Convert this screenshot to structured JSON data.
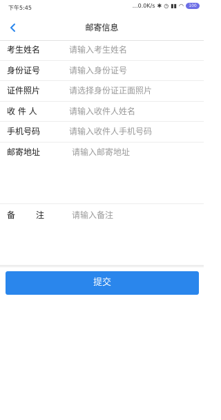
{
  "status_bar": {
    "time": "下午5:45",
    "network_speed": "…0.0K/s",
    "battery": "100"
  },
  "header": {
    "title": "邮寄信息"
  },
  "form": {
    "fields": [
      {
        "label": "考生姓名",
        "placeholder": "请输入考生姓名"
      },
      {
        "label": "身份证号",
        "placeholder": "请输入身份证号"
      },
      {
        "label": "证件照片",
        "placeholder": "请选择身份证正面照片"
      },
      {
        "label": "收 件 人",
        "placeholder": "请输入收件人姓名"
      },
      {
        "label": "手机号码",
        "placeholder": "请输入收件人手机号码"
      },
      {
        "label": "邮寄地址",
        "placeholder": "请输入邮寄地址"
      },
      {
        "label": "备　　注",
        "placeholder": "请输入备注"
      }
    ]
  },
  "actions": {
    "submit_label": "提交"
  },
  "colors": {
    "accent": "#2a86ec",
    "back_arrow": "#2a86ec",
    "placeholder": "#9a9a9a"
  }
}
